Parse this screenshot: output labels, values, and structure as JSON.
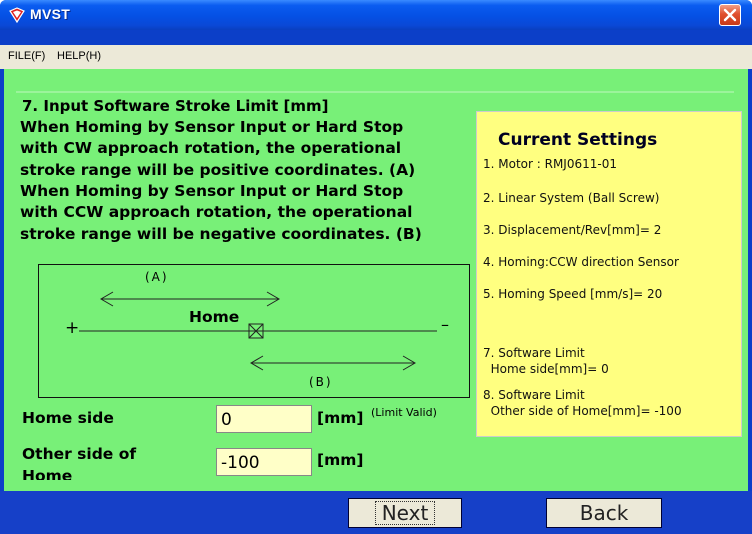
{
  "window": {
    "title": "MVST"
  },
  "menu": {
    "file": "FILE(F)",
    "help": "HELP(H)"
  },
  "instruction": {
    "lines": [
      "7. Input Software Stroke Limit [mm]",
      "When Homing by Sensor Input or Hard Stop",
      "with CW approach rotation, the operational",
      "stroke range will be positive coordinates. (A)",
      " When Homing by Sensor Input or Hard Stop",
      "with CCW approach rotation, the operational",
      "stroke range will be negative coordinates. (B)"
    ]
  },
  "diagram": {
    "label_a": "(A)",
    "label_b": "(B)",
    "plus": "+",
    "minus": "–",
    "home": "Home"
  },
  "fields": {
    "home_side_label": "Home side",
    "home_side_value": "0",
    "home_side_unit": "[mm]",
    "limit_valid": "(Limit Valid)",
    "other_side_label": "Other side of",
    "other_side_label2": "Home",
    "other_side_value": "-100",
    "other_side_unit": "[mm]"
  },
  "settings": {
    "title": "Current Settings",
    "lines": [
      "1. Motor : RMJ0611-01",
      "2. Linear System (Ball Screw)",
      "3. Displacement/Rev[mm]= 2",
      "4. Homing:CCW direction Sensor",
      "5. Homing Speed [mm/s]= 20",
      "7. Software Limit",
      "  Home side[mm]= 0",
      "8. Software Limit",
      "  Other side of Home[mm]= -100"
    ]
  },
  "buttons": {
    "next": "Next",
    "back": "Back"
  },
  "colors": {
    "client_bg": "#78f078",
    "settings_bg": "#ffff80",
    "titlebar": "#0550e4",
    "input_bg": "#ffffc8"
  }
}
